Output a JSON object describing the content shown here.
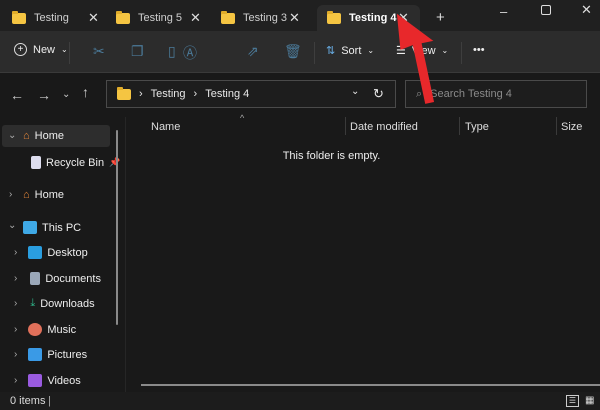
{
  "tabs": [
    {
      "label": "Testing",
      "active": false
    },
    {
      "label": "Testing 5",
      "active": false
    },
    {
      "label": "Testing 3",
      "active": false
    },
    {
      "label": "Testing 4",
      "active": true
    }
  ],
  "toolbar": {
    "new": "New",
    "sort": "Sort",
    "view": "View",
    "more": "•••"
  },
  "address": {
    "crumbs": [
      "Testing",
      "Testing 4"
    ]
  },
  "search": {
    "placeholder": "Search Testing 4"
  },
  "sidebar": {
    "home": "Home",
    "recycle": "Recycle Bin",
    "home2": "Home",
    "thispc": "This PC",
    "items": [
      "Desktop",
      "Documents",
      "Downloads",
      "Music",
      "Pictures",
      "Videos"
    ]
  },
  "columns": {
    "name": "Name",
    "date": "Date modified",
    "type": "Type",
    "size": "Size"
  },
  "empty": "This folder is empty.",
  "status": {
    "items": "0 items"
  },
  "colors": {
    "accent": "#f5c542",
    "arrow": "#e8282b"
  }
}
